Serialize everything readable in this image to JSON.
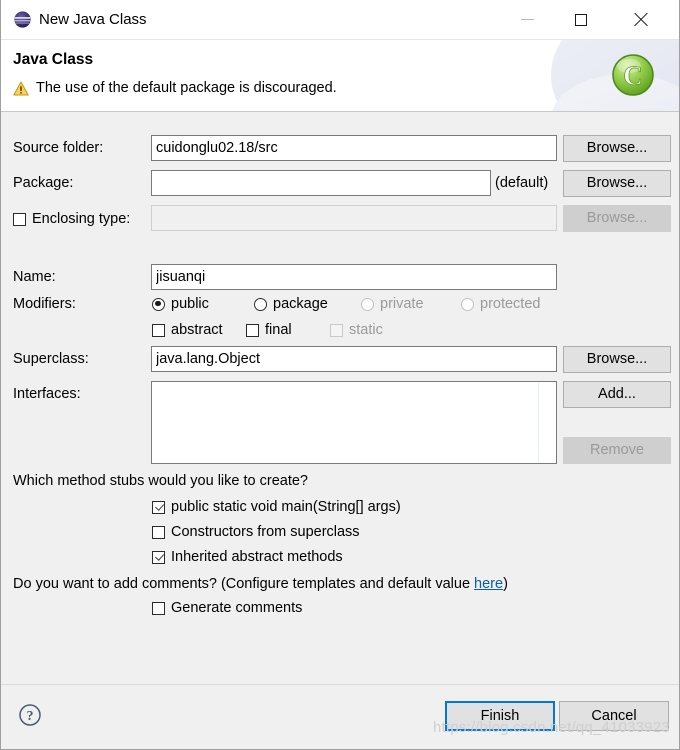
{
  "window": {
    "title": "New Java Class",
    "icon": "eclipse-sphere-icon",
    "minimize_label": "—",
    "maximize_label": "☐",
    "close_label": "✕"
  },
  "header": {
    "title": "Java Class",
    "message": "The use of the default package is discouraged.",
    "warning_icon": "warning-triangle-icon",
    "badge_icon": "green-class-c-icon",
    "badge_letter": "C"
  },
  "form": {
    "source_folder": {
      "label": "Source folder:",
      "value": "cuidonglu02.18/src",
      "browse_label": "Browse..."
    },
    "package": {
      "label": "Package:",
      "value": "",
      "suffix": "(default)",
      "browse_label": "Browse..."
    },
    "enclosing_type": {
      "label": "Enclosing type:",
      "checked": false,
      "value": "",
      "browse_label": "Browse...",
      "enabled": false
    },
    "name": {
      "label": "Name:",
      "value": "jisuanqi"
    },
    "modifiers": {
      "label": "Modifiers:",
      "access": [
        {
          "label": "public",
          "selected": true,
          "enabled": true
        },
        {
          "label": "package",
          "selected": false,
          "enabled": true
        },
        {
          "label": "private",
          "selected": false,
          "enabled": false
        },
        {
          "label": "protected",
          "selected": false,
          "enabled": false
        }
      ],
      "flags": [
        {
          "label": "abstract",
          "checked": false,
          "enabled": true
        },
        {
          "label": "final",
          "checked": false,
          "enabled": true
        },
        {
          "label": "static",
          "checked": false,
          "enabled": false
        }
      ]
    },
    "superclass": {
      "label": "Superclass:",
      "value": "java.lang.Object",
      "browse_label": "Browse..."
    },
    "interfaces": {
      "label": "Interfaces:",
      "items": [],
      "add_label": "Add...",
      "remove_label": "Remove",
      "remove_enabled": false
    }
  },
  "stubs": {
    "question": "Which method stubs would you like to create?",
    "options": [
      {
        "label": "public static void main(String[] args)",
        "checked": true
      },
      {
        "label": "Constructors from superclass",
        "checked": false
      },
      {
        "label": "Inherited abstract methods",
        "checked": true
      }
    ]
  },
  "comments": {
    "question_prefix": "Do you want to add comments? (Configure templates and default value ",
    "link_label": "here",
    "question_suffix": ")",
    "option": {
      "label": "Generate comments",
      "checked": false
    }
  },
  "footer": {
    "help_icon": "help-question-icon",
    "finish_label": "Finish",
    "cancel_label": "Cancel"
  },
  "watermark": "https://blog.csdn.net/qq_41033923",
  "colors": {
    "accent": "#0078d7",
    "link": "#0b5fa5",
    "dialog_bg": "#f0f0f0",
    "warning": "#f0b429",
    "badge_green": "#7ec344"
  }
}
